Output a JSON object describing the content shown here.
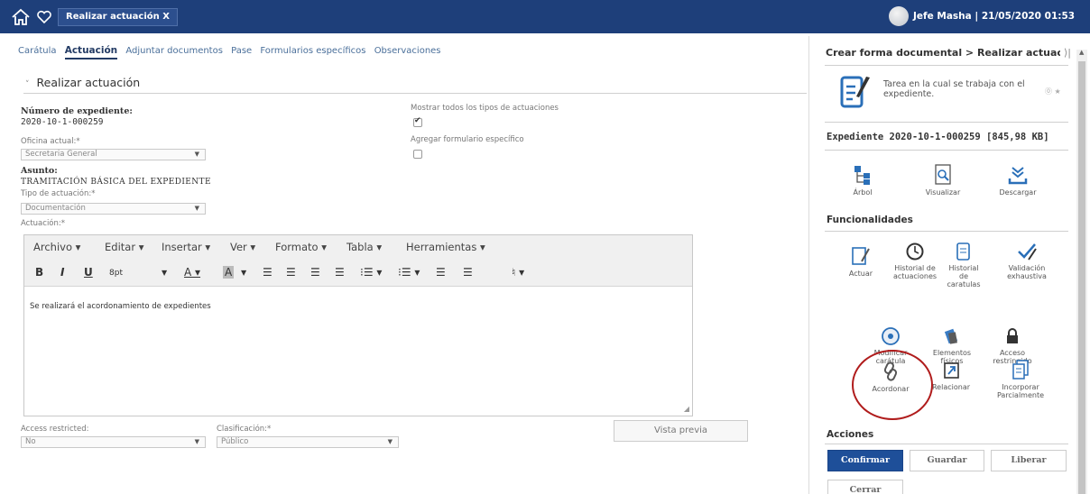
{
  "header": {
    "tab_title": "Realizar actuación X",
    "user_info": "Jefe Masha | 21/05/2020 01:53"
  },
  "tabs": [
    {
      "label": "Carátula"
    },
    {
      "label": "Actuación"
    },
    {
      "label": "Adjuntar documentos"
    },
    {
      "label": "Pase"
    },
    {
      "label": "Formularios específicos"
    },
    {
      "label": "Observaciones"
    }
  ],
  "form": {
    "section_title": "Realizar actuación",
    "expediente_label": "Número de expediente:",
    "expediente_value": "2020-10-1-000259",
    "oficina_label": "Oficina actual:*",
    "oficina_value": "Secretaria General",
    "asunto_label": "Asunto:",
    "asunto_value": "TRAMITACIÓN BÁSICA DEL EXPEDIENTE",
    "tipo_label": "Tipo de actuación:*",
    "tipo_value": "Documentación",
    "actuacion_label": "Actuación:*",
    "mostrar_label": "Mostrar todos los tipos de actuaciones",
    "mostrar_checked": true,
    "agregar_label": "Agregar formulario específico",
    "agregar_checked": false,
    "acceso_label": "Access restricted:",
    "acceso_value": "No",
    "clasif_label": "Clasificación:*",
    "clasif_value": "Público",
    "preview_button": "Vista previa"
  },
  "editor": {
    "menus": [
      "Archivo ▾",
      "Editar ▾",
      "Insertar ▾",
      "Ver ▾",
      "Formato ▾",
      "Tabla ▾",
      "Herramientas ▾"
    ],
    "bold": "B",
    "italic": "I",
    "underline": "U",
    "font_size": "8pt",
    "content": "Se realizará el acordonamiento de expedientes"
  },
  "right_panel": {
    "breadcrumb": "Crear forma documental > Realizar actuación",
    "collapse": "⟩|",
    "task_description": "Tarea en la cual se trabaja con el expediente.",
    "help": "⓪ ★",
    "expediente_info": "Expediente 2020-10-1-000259 [845,98 KB]",
    "top_actions": [
      {
        "label": "Árbol",
        "icon": "tree-icon"
      },
      {
        "label": "Visualizar",
        "icon": "preview-icon"
      },
      {
        "label": "Descargar",
        "icon": "download-icon"
      }
    ],
    "functionalities_title": "Funcionalidades",
    "functionalities": [
      {
        "label": "Actuar",
        "icon": "edit-document-icon"
      },
      {
        "label": "Historial de actuaciones",
        "icon": "clock-icon"
      },
      {
        "label": "Historial de caratulas",
        "icon": "document-history-icon"
      },
      {
        "label": "Validación exhaustiva",
        "icon": "check-pen-icon"
      },
      {
        "label": "Modificar carátula",
        "icon": "disc-edit-icon"
      },
      {
        "label": "Elementos físicos",
        "icon": "physical-elements-icon"
      },
      {
        "label": "Acceso restringido",
        "icon": "lock-icon"
      },
      {
        "label": "Acordonar",
        "icon": "link-icon"
      },
      {
        "label": "Relacionar",
        "icon": "relate-icon"
      },
      {
        "label": "Incorporar Parcialmente",
        "icon": "incorporate-icon"
      }
    ],
    "actions_title": "Acciones",
    "buttons": {
      "confirm": "Confirmar",
      "save": "Guardar",
      "release": "Liberar",
      "close": "Cerrar"
    },
    "colors": {
      "header": "#1e3f7a",
      "primary_button": "#1e4f99",
      "highlight_circle": "#b01c1c"
    }
  }
}
